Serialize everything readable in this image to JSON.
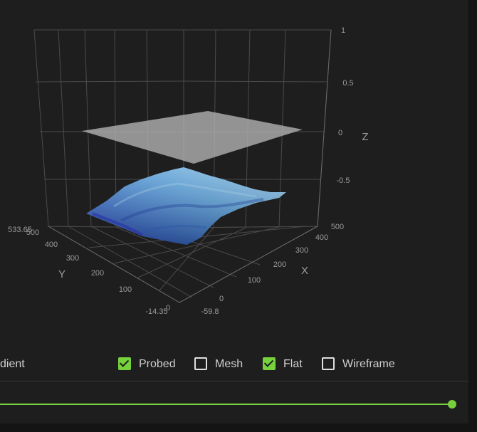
{
  "chart_data": {
    "type": "surface3d",
    "x_axis": {
      "label": "X",
      "ticks": [
        "-59.8",
        "0",
        "100",
        "200",
        "300",
        "400",
        "500"
      ]
    },
    "y_axis": {
      "label": "Y",
      "ticks": [
        "-14.35",
        "0",
        "100",
        "200",
        "300",
        "400",
        "500",
        "533.65"
      ]
    },
    "z_axis": {
      "label": "Z",
      "ticks": [
        "-0.5",
        "0",
        "0.5",
        "1"
      ]
    },
    "z_range": [
      -1,
      1
    ],
    "series": [
      {
        "name": "Probed",
        "visible": true,
        "color": "#4a8fd0"
      },
      {
        "name": "Mesh",
        "visible": false
      },
      {
        "name": "Flat",
        "visible": true,
        "z": 0,
        "color": "#bdbdbd"
      },
      {
        "name": "Wireframe",
        "visible": false
      }
    ]
  },
  "controls": {
    "gradient_label": "dient",
    "probed_label": "Probed",
    "probed_checked": true,
    "mesh_label": "Mesh",
    "mesh_checked": false,
    "flat_label": "Flat",
    "flat_checked": true,
    "wireframe_label": "Wireframe",
    "wireframe_checked": false
  },
  "slider": {
    "value": 1.0
  },
  "colors": {
    "accent": "#76d13c",
    "background": "#1e1e1e"
  }
}
